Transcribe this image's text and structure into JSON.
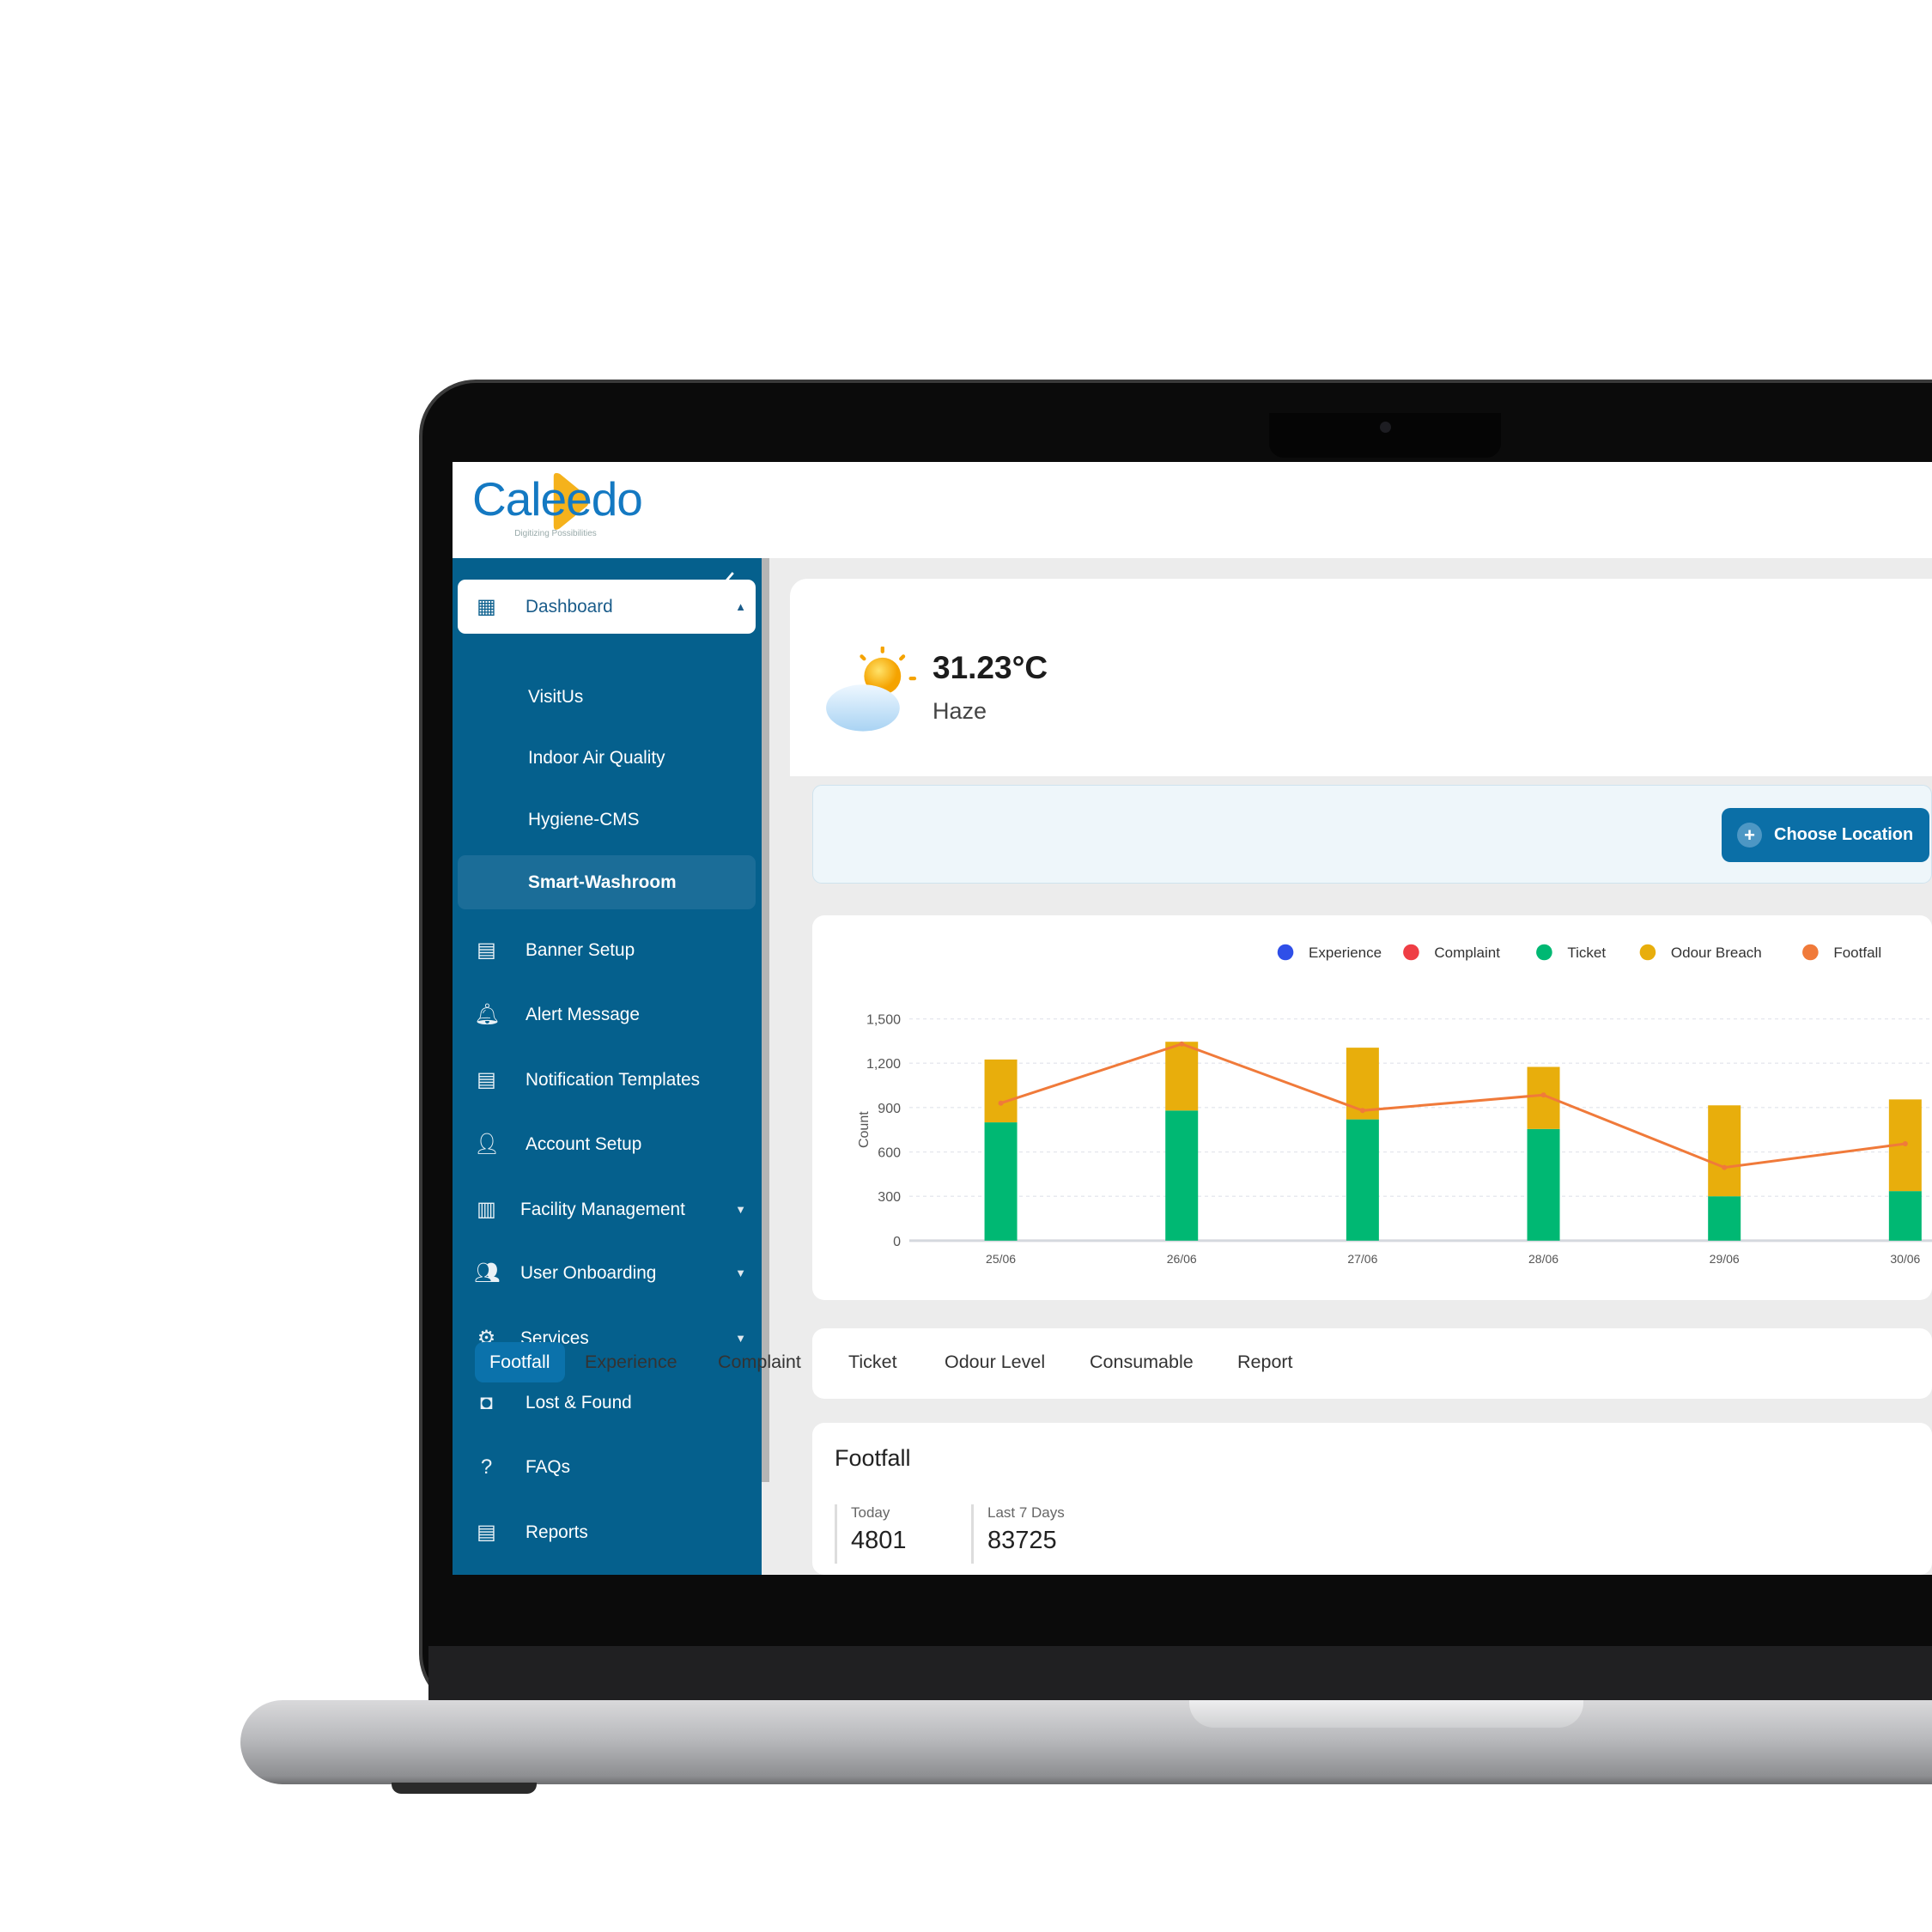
{
  "brand": {
    "logo_text": "Caleedo",
    "tagline": "Digitizing Possibilities",
    "colors": {
      "primary": "#05608d",
      "accent": "#f5b21c"
    }
  },
  "sidebar": {
    "collapse_icon": "chevron-left-icon",
    "items": [
      {
        "label": "Dashboard",
        "icon": "grid-icon",
        "expanded": true,
        "active": true
      },
      {
        "label": "VisitUs",
        "sub": true
      },
      {
        "label": "Indoor Air Quality",
        "sub": true
      },
      {
        "label": "Hygiene-CMS",
        "sub": true
      },
      {
        "label": "Smart-Washroom",
        "sub": true,
        "selected": true
      },
      {
        "label": "Banner Setup",
        "icon": "document-icon"
      },
      {
        "label": "Alert Message",
        "icon": "bell-icon"
      },
      {
        "label": "Notification Templates",
        "icon": "notification-icon"
      },
      {
        "label": "Account Setup",
        "icon": "user-gear-icon"
      },
      {
        "label": "Facility Management",
        "icon": "chart-box-icon",
        "has_submenu": true
      },
      {
        "label": "User Onboarding",
        "icon": "users-icon",
        "has_submenu": true
      },
      {
        "label": "Services",
        "icon": "gear-icon",
        "has_submenu": true
      },
      {
        "label": "Lost & Found",
        "icon": "lost-bag-icon"
      },
      {
        "label": "FAQs",
        "icon": "question-bubble-icon"
      },
      {
        "label": "Reports",
        "icon": "clipboard-icon"
      }
    ]
  },
  "weather": {
    "temperature": "31.23°C",
    "condition": "Haze",
    "icon": "sun-cloud-icon"
  },
  "location": {
    "button_label": "Choose Location"
  },
  "chart_data": {
    "type": "bar",
    "stacked": true,
    "categories": [
      "25/06",
      "26/06",
      "27/06",
      "28/06",
      "29/06",
      "30/06"
    ],
    "ylabel": "Count",
    "ylim": [
      0,
      1500
    ],
    "yticks": [
      "0",
      "300",
      "600",
      "900",
      "1,200",
      "1,500"
    ],
    "grid": true,
    "legend_position": "top-center",
    "series": [
      {
        "name": "Experience",
        "color": "#2f4fe8",
        "values": [
          0,
          0,
          0,
          0,
          0,
          0
        ]
      },
      {
        "name": "Complaint",
        "color": "#ef3e45",
        "values": [
          0,
          0,
          0,
          0,
          0,
          0
        ]
      },
      {
        "name": "Ticket",
        "color": "#00b873",
        "values": [
          800,
          880,
          820,
          755,
          300,
          335
        ]
      },
      {
        "name": "Odour Breach",
        "color": "#e8ae0c",
        "values": [
          425,
          465,
          485,
          420,
          615,
          620
        ]
      },
      {
        "name": "Footfall",
        "type": "line",
        "color": "#f07a3a",
        "values": [
          930,
          1330,
          880,
          985,
          495,
          655
        ]
      }
    ]
  },
  "tabs": [
    {
      "label": "Footfall",
      "active": true
    },
    {
      "label": "Experience"
    },
    {
      "label": "Complaint"
    },
    {
      "label": "Ticket"
    },
    {
      "label": "Odour Level"
    },
    {
      "label": "Consumable"
    },
    {
      "label": "Report"
    }
  ],
  "footfall": {
    "title": "Footfall",
    "today_label": "Today",
    "today_value": "4801",
    "week_label": "Last 7 Days",
    "week_value": "83725"
  }
}
